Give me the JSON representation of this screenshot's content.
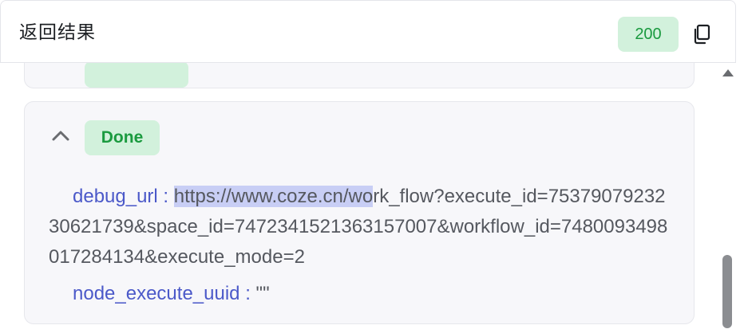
{
  "header": {
    "title": "返回结果",
    "status_code": "200",
    "copy_icon": "copy-icon"
  },
  "result": {
    "state": "Done",
    "toggle_icon": "chevron-up-icon",
    "debug_url_key": "debug_url",
    "separator": " : ",
    "debug_url_selected": "https://www.coze.cn/wo",
    "debug_url_rest": "rk_flow?execute_id=7537907923230621739&space_id=7472341521363157007&workflow_id=7480093498017284134&execute_mode=2",
    "node_execute_uuid_key": "node_execute_uuid",
    "node_execute_uuid_value": "\"\""
  },
  "colors": {
    "accent_key": "#4b59c9",
    "success_bg": "#d2f1dc",
    "success_text": "#1a9a3f",
    "selection": "#c8cef5"
  }
}
